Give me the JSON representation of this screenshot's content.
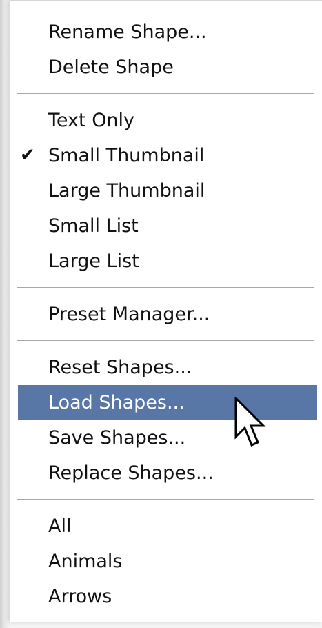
{
  "menu": {
    "items": [
      {
        "label": "Rename Shape..."
      },
      {
        "label": "Delete Shape"
      },
      {
        "label": "Text Only"
      },
      {
        "label": "Small Thumbnail",
        "checked": true
      },
      {
        "label": "Large Thumbnail"
      },
      {
        "label": "Small List"
      },
      {
        "label": "Large List"
      },
      {
        "label": "Preset Manager..."
      },
      {
        "label": "Reset Shapes..."
      },
      {
        "label": "Load Shapes...",
        "highlighted": true
      },
      {
        "label": "Save Shapes..."
      },
      {
        "label": "Replace Shapes..."
      },
      {
        "label": "All"
      },
      {
        "label": "Animals"
      },
      {
        "label": "Arrows"
      }
    ],
    "check_glyph": "✔"
  },
  "colors": {
    "highlight": "#5876a6",
    "text": "#111111",
    "separator": "#a8a8a8"
  },
  "cursor_icon": "arrow-cursor-icon"
}
